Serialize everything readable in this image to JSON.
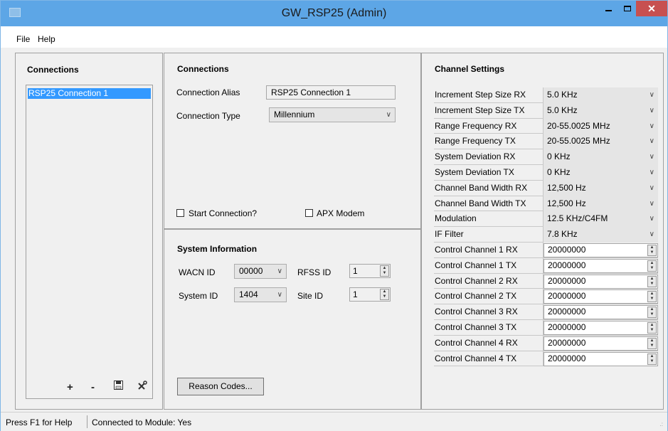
{
  "window": {
    "title": "GW_RSP25 (Admin)",
    "minimize_label": "–",
    "close_label": "✕"
  },
  "menu": {
    "file": "File",
    "help": "Help"
  },
  "connections_panel": {
    "heading": "Connections",
    "items": [
      {
        "label": "RSP25 Connection 1",
        "selected": true
      }
    ],
    "tools": {
      "add": "+",
      "remove": "-",
      "save_icon": "floppy-disk-icon",
      "settings_icon": "tools-icon"
    }
  },
  "connection_details": {
    "heading": "Connections",
    "alias_label": "Connection Alias",
    "alias_value": "RSP25 Connection 1",
    "type_label": "Connection Type",
    "type_value": "Millennium",
    "start_connection_label": "Start Connection?",
    "start_connection_checked": false,
    "apx_modem_label": "APX Modem",
    "apx_modem_checked": false
  },
  "system_information": {
    "heading": "System Information",
    "wacn_label": "WACN ID",
    "wacn_value": "00000",
    "rfss_label": "RFSS ID",
    "rfss_value": "1",
    "system_id_label": "System ID",
    "system_id_value": "1404",
    "site_id_label": "Site ID",
    "site_id_value": "1",
    "reason_codes_label": "Reason Codes..."
  },
  "channel_settings": {
    "heading": "Channel Settings",
    "rows": [
      {
        "name": "Increment Step Size RX",
        "value": "5.0 KHz",
        "kind": "dropdown"
      },
      {
        "name": "Increment Step Size TX",
        "value": "5.0 KHz",
        "kind": "dropdown"
      },
      {
        "name": "Range Frequency RX",
        "value": "20-55.0025 MHz",
        "kind": "dropdown"
      },
      {
        "name": "Range Frequency TX",
        "value": "20-55.0025 MHz",
        "kind": "dropdown"
      },
      {
        "name": "System Deviation RX",
        "value": "0 KHz",
        "kind": "dropdown"
      },
      {
        "name": "System Deviation TX",
        "value": "0 KHz",
        "kind": "dropdown"
      },
      {
        "name": "Channel Band Width RX",
        "value": "12,500 Hz",
        "kind": "dropdown"
      },
      {
        "name": "Channel Band Width TX",
        "value": "12,500 Hz",
        "kind": "dropdown"
      },
      {
        "name": "Modulation",
        "value": "12.5 KHz/C4FM",
        "kind": "dropdown"
      },
      {
        "name": "IF Filter",
        "value": "7.8 KHz",
        "kind": "dropdown"
      },
      {
        "name": "Control Channel 1 RX",
        "value": "20000000",
        "kind": "numeric"
      },
      {
        "name": "Control Channel 1 TX",
        "value": "20000000",
        "kind": "numeric"
      },
      {
        "name": "Control Channel 2 RX",
        "value": "20000000",
        "kind": "numeric"
      },
      {
        "name": "Control Channel 2 TX",
        "value": "20000000",
        "kind": "numeric"
      },
      {
        "name": "Control Channel 3 RX",
        "value": "20000000",
        "kind": "numeric"
      },
      {
        "name": "Control Channel 3 TX",
        "value": "20000000",
        "kind": "numeric"
      },
      {
        "name": "Control Channel 4 RX",
        "value": "20000000",
        "kind": "numeric"
      },
      {
        "name": "Control Channel 4 TX",
        "value": "20000000",
        "kind": "numeric"
      }
    ]
  },
  "status_bar": {
    "help_text": "Press F1 for Help",
    "connection_status": "Connected to Module: Yes"
  },
  "colors": {
    "titlebar": "#5da6e6",
    "close_button": "#c75050",
    "selection": "#3399ff",
    "panel_background": "#f0f0f0"
  }
}
